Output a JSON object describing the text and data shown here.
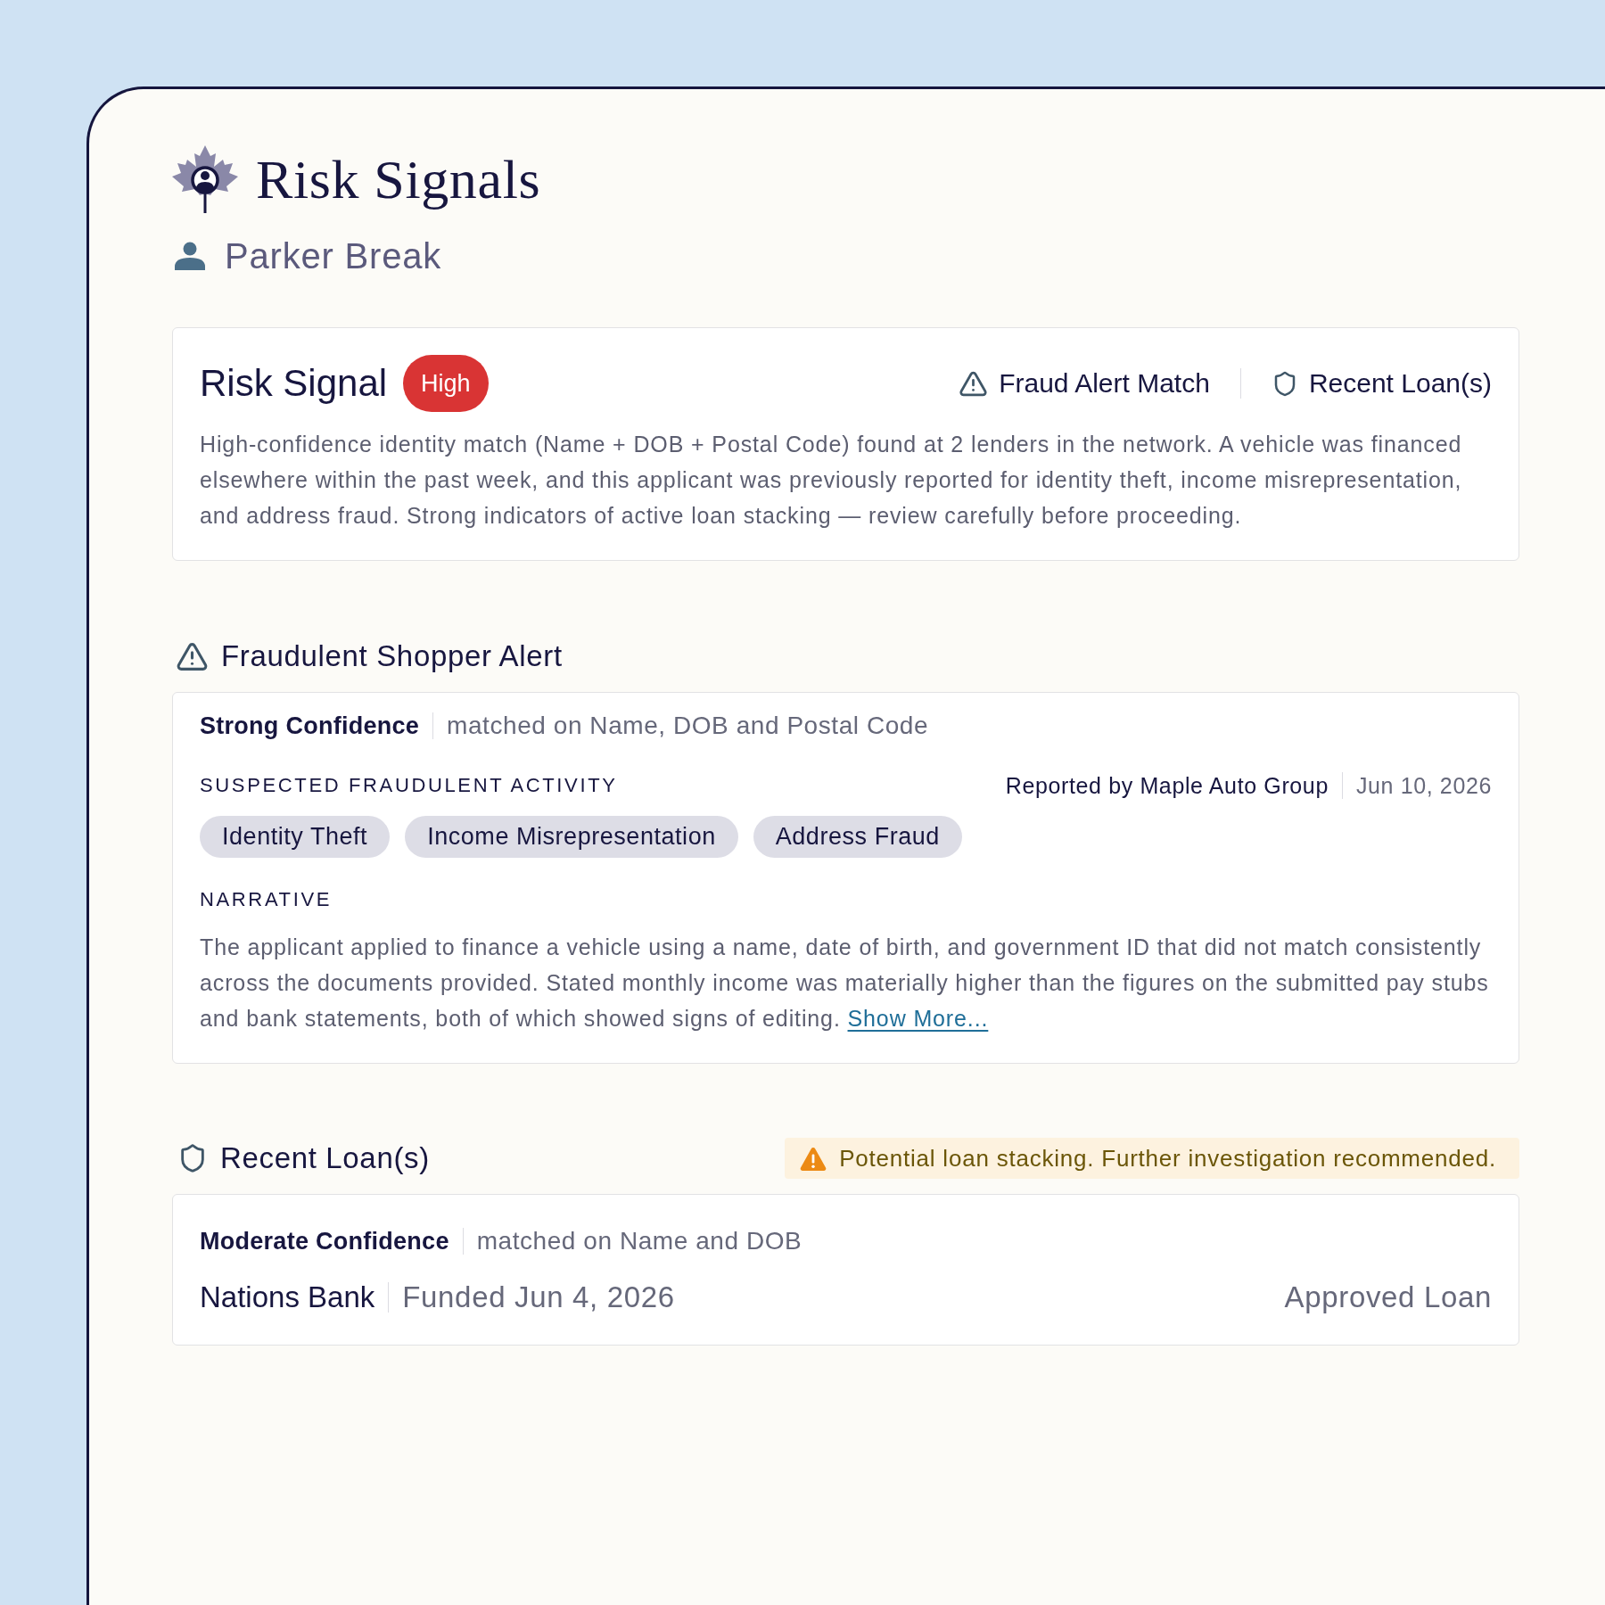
{
  "header": {
    "title": "Risk Signals",
    "applicant": "Parker Break"
  },
  "risk_signal": {
    "title": "Risk Signal",
    "severity": {
      "label": "High",
      "kind": "high"
    },
    "sources": [
      {
        "kind": "alert",
        "label": "Fraud Alert Match"
      },
      {
        "kind": "loan",
        "label": "Recent Loan(s)"
      }
    ],
    "summary": "High-confidence identity match (Name + DOB + Postal Code) found at 2 lenders in the network. A vehicle was financed elsewhere within the past week, and this applicant was previously reported for identity theft, income misrepresentation, and address fraud. Strong indicators of active loan stacking — review carefully before proceeding."
  },
  "fraud_alert": {
    "title": "Fraudulent Shopper Alert",
    "confidence": "Strong Confidence",
    "match_basis": "matched on Name, DOB and Postal Code",
    "activity_heading": "SUSPECTED FRAUDULENT ACTIVITY",
    "reported_by": "Reported by Maple Auto Group",
    "reported_date": "Jun 10, 2026",
    "activities": [
      "Identity Theft",
      "Income Misrepresentation",
      "Address Fraud"
    ],
    "narrative_heading": "NARRATIVE",
    "narrative": "The applicant applied to finance a vehicle using a name, date of birth, and government ID that did not match consistently across the documents provided. Stated monthly income was materially higher than the figures on the submitted pay stubs and bank statements, both of which showed signs of editing.",
    "show_more_link": "Show More..."
  },
  "recent_loans": {
    "title": "Recent Loan(s)",
    "warning": "Potential loan stacking. Further investigation recommended.",
    "loans": [
      {
        "confidence": "Moderate Confidence",
        "match_basis": "matched on Name and DOB",
        "lender": "Nations Bank",
        "funded": "Funded Jun 4, 2026",
        "status": "Approved Loan"
      }
    ]
  }
}
